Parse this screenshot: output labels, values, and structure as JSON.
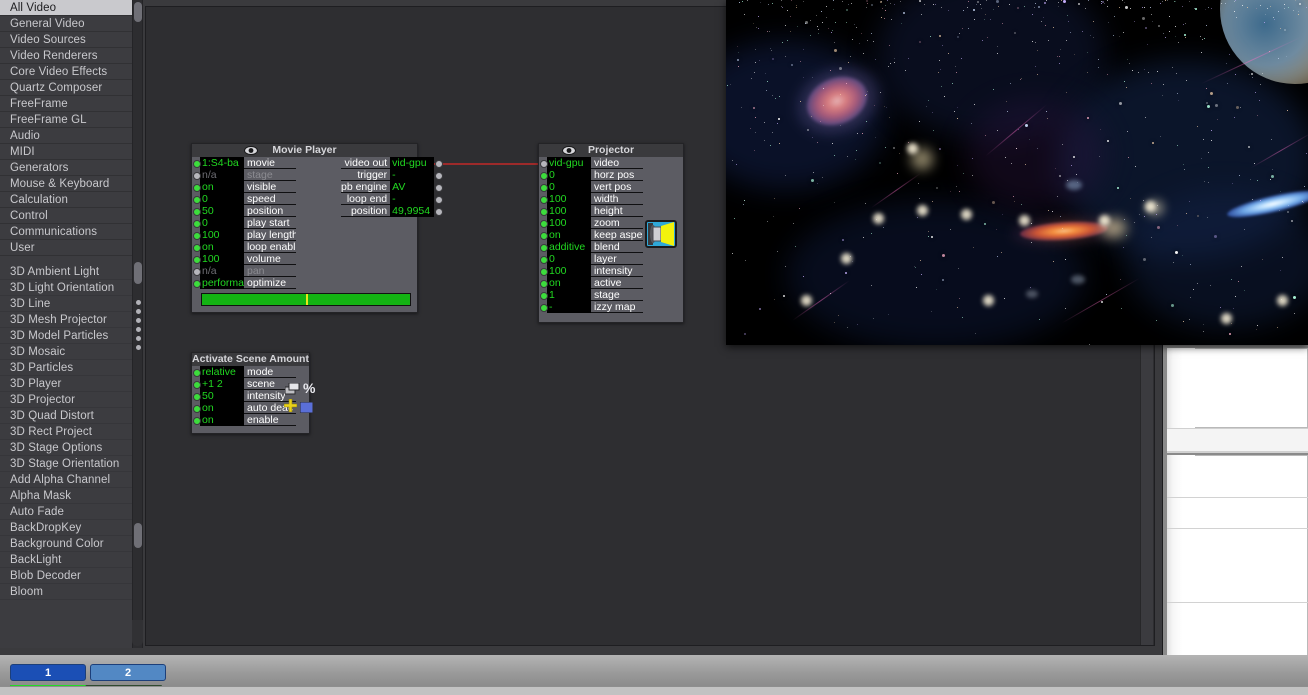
{
  "app": {
    "accent_selected": "#1b4fb5",
    "accent_unselected": "#5288c4",
    "value_green": "#21d821",
    "wire_color": "#9d2a2a"
  },
  "sidebar": {
    "categories": [
      {
        "label": "All Video",
        "selected": true
      },
      {
        "label": "General Video",
        "selected": false
      },
      {
        "label": "Video Sources",
        "selected": false
      },
      {
        "label": "Video Renderers",
        "selected": false
      },
      {
        "label": "Core Video Effects",
        "selected": false
      },
      {
        "label": "Quartz Composer",
        "selected": false
      },
      {
        "label": "FreeFrame",
        "selected": false
      },
      {
        "label": "FreeFrame GL",
        "selected": false
      },
      {
        "label": "Audio",
        "selected": false
      },
      {
        "label": "MIDI",
        "selected": false
      },
      {
        "label": "Generators",
        "selected": false
      },
      {
        "label": "Mouse & Keyboard",
        "selected": false
      },
      {
        "label": "Calculation",
        "selected": false
      },
      {
        "label": "Control",
        "selected": false
      },
      {
        "label": "Communications",
        "selected": false
      },
      {
        "label": "User",
        "selected": false
      }
    ],
    "actors": [
      {
        "label": "3D Ambient Light"
      },
      {
        "label": "3D Light Orientation"
      },
      {
        "label": "3D Line"
      },
      {
        "label": "3D Mesh Projector"
      },
      {
        "label": "3D Model Particles"
      },
      {
        "label": "3D Mosaic"
      },
      {
        "label": "3D Particles"
      },
      {
        "label": "3D Player"
      },
      {
        "label": "3D Projector"
      },
      {
        "label": "3D Quad Distort"
      },
      {
        "label": "3D Rect Project"
      },
      {
        "label": "3D Stage Options"
      },
      {
        "label": "3D Stage Orientation"
      },
      {
        "label": "Add Alpha Channel"
      },
      {
        "label": "Alpha Mask"
      },
      {
        "label": "Auto Fade"
      },
      {
        "label": "BackDropKey"
      },
      {
        "label": "Background Color"
      },
      {
        "label": "BackLight"
      },
      {
        "label": "Blob Decoder"
      },
      {
        "label": "Bloom"
      }
    ]
  },
  "nodes": {
    "movie_player": {
      "title": "Movie Player",
      "inputs": [
        {
          "value": "1:S4-ba",
          "label": "movie",
          "plug": "on",
          "dim_label": false,
          "dim_value": false
        },
        {
          "value": "n/a",
          "label": "stage",
          "plug": "off",
          "dim_label": true,
          "dim_value": true
        },
        {
          "value": "on",
          "label": "visible",
          "plug": "on",
          "dim_label": false,
          "dim_value": false
        },
        {
          "value": "0",
          "label": "speed",
          "plug": "on",
          "dim_label": false,
          "dim_value": false
        },
        {
          "value": "50",
          "label": "position",
          "plug": "on",
          "dim_label": false,
          "dim_value": false
        },
        {
          "value": "0",
          "label": "play start",
          "plug": "on",
          "dim_label": false,
          "dim_value": false
        },
        {
          "value": "100",
          "label": "play length",
          "plug": "on",
          "dim_label": false,
          "dim_value": false
        },
        {
          "value": "on",
          "label": "loop enable",
          "plug": "on",
          "dim_label": false,
          "dim_value": false
        },
        {
          "value": "100",
          "label": "volume",
          "plug": "on",
          "dim_label": false,
          "dim_value": false
        },
        {
          "value": "n/a",
          "label": "pan",
          "plug": "off",
          "dim_label": true,
          "dim_value": true
        },
        {
          "value": "performa",
          "label": "optimize",
          "plug": "on",
          "dim_label": false,
          "dim_value": false
        }
      ],
      "outputs": [
        {
          "label": "video out",
          "value": "vid-gpu",
          "plug": "conn"
        },
        {
          "label": "trigger",
          "value": "-",
          "plug": "off"
        },
        {
          "label": "pb engine",
          "value": "AV",
          "plug": "off"
        },
        {
          "label": "loop end",
          "value": "-",
          "plug": "off"
        },
        {
          "label": "position",
          "value": "49,9954",
          "plug": "off"
        }
      ],
      "progress_percent": 50
    },
    "projector": {
      "title": "Projector",
      "inputs": [
        {
          "value": "vid-gpu",
          "label": "video",
          "plug": "conn"
        },
        {
          "value": "0",
          "label": "horz pos",
          "plug": "on"
        },
        {
          "value": "0",
          "label": "vert pos",
          "plug": "on"
        },
        {
          "value": "100",
          "label": "width",
          "plug": "on"
        },
        {
          "value": "100",
          "label": "height",
          "plug": "on"
        },
        {
          "value": "100",
          "label": "zoom",
          "plug": "on"
        },
        {
          "value": "on",
          "label": "keep aspect",
          "plug": "on"
        },
        {
          "value": "additive",
          "label": "blend",
          "plug": "on"
        },
        {
          "value": "0",
          "label": "layer",
          "plug": "on"
        },
        {
          "value": "100",
          "label": "intensity",
          "plug": "on"
        },
        {
          "value": "on",
          "label": "active",
          "plug": "on"
        },
        {
          "value": "1",
          "label": "stage",
          "plug": "on"
        },
        {
          "value": "-",
          "label": "izzy map",
          "plug": "on"
        }
      ],
      "icon": "projector-icon"
    },
    "activate_scene": {
      "title": "Activate Scene Amount",
      "inputs": [
        {
          "value": "relative",
          "label": "mode",
          "plug": "on"
        },
        {
          "value": "+1 2",
          "label": "scene",
          "plug": "on"
        },
        {
          "value": "50",
          "label": "intensity",
          "plug": "on"
        },
        {
          "value": "on",
          "label": "auto deac",
          "plug": "on"
        },
        {
          "value": "on",
          "label": "enable",
          "plug": "on"
        }
      ],
      "icons": [
        "scenes-icon",
        "percent-icon",
        "plus-icon",
        "color-swatch-icon"
      ]
    }
  },
  "scene_tabs": [
    {
      "label": "1",
      "selected": true
    },
    {
      "label": "2",
      "selected": false
    }
  ],
  "scene_progress_percent": 50
}
